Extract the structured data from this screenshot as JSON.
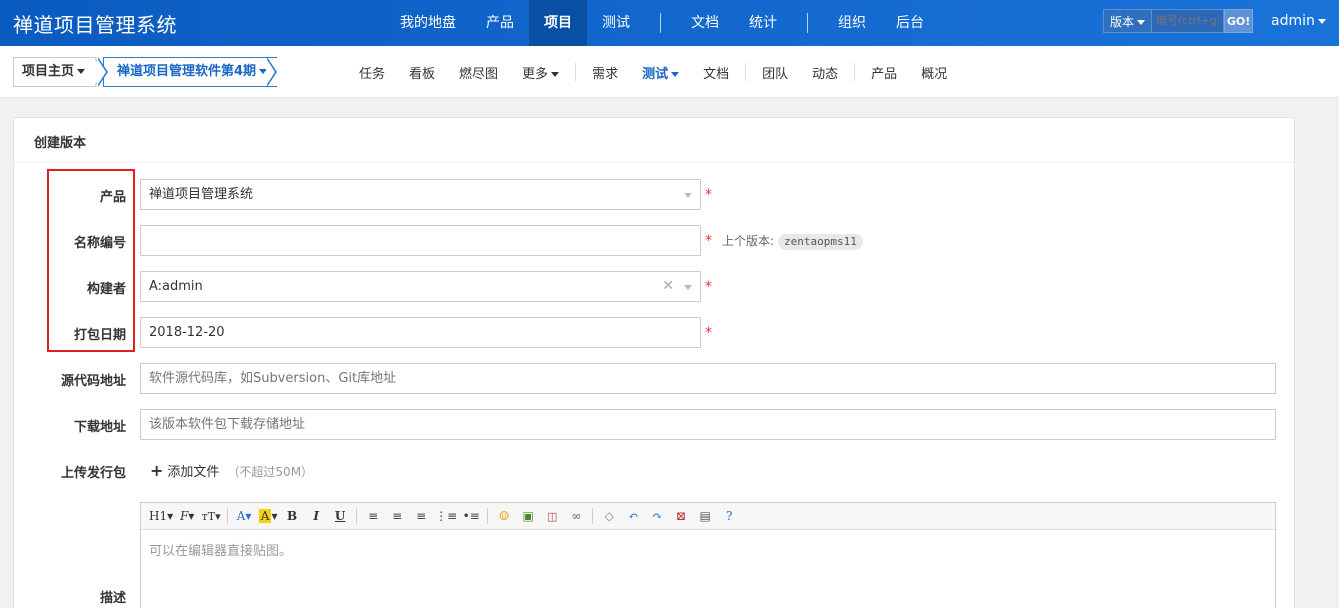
{
  "header": {
    "brand": "禅道项目管理系统",
    "nav": [
      {
        "label": "我的地盘",
        "active": false
      },
      {
        "label": "产品",
        "active": false
      },
      {
        "label": "项目",
        "active": true
      },
      {
        "label": "测试",
        "active": false
      },
      {
        "label": "文档",
        "active": false
      },
      {
        "label": "统计",
        "active": false
      },
      {
        "label": "组织",
        "active": false
      },
      {
        "label": "后台",
        "active": false
      }
    ],
    "search": {
      "type_label": "版本",
      "placeholder": "编号(ctrl+g)",
      "go_label": "GO!"
    },
    "user": "admin"
  },
  "subnav": {
    "crumb_home": "项目主页",
    "crumb_project": "禅道项目管理软件第4期",
    "menu": [
      "任务",
      "看板",
      "燃尽图",
      "更多",
      "需求",
      "测试",
      "文档",
      "团队",
      "动态",
      "产品",
      "概况"
    ]
  },
  "form": {
    "title": "创建版本",
    "product": {
      "label": "产品",
      "value": "禅道项目管理系统"
    },
    "name": {
      "label": "名称编号",
      "value": "",
      "last_version_label": "上个版本:",
      "last_version_value": "zentaopms11"
    },
    "builder": {
      "label": "构建者",
      "value": "A:admin"
    },
    "date": {
      "label": "打包日期",
      "value": "2018-12-20"
    },
    "scm": {
      "label": "源代码地址",
      "placeholder": "软件源代码库，如Subversion、Git库地址"
    },
    "download": {
      "label": "下载地址",
      "placeholder": "该版本软件包下载存储地址"
    },
    "upload": {
      "label": "上传发行包",
      "add_label": "添加文件",
      "limit": "（不超过50M）"
    },
    "desc": {
      "label": "描述",
      "placeholder": "可以在编辑器直接贴图。"
    }
  },
  "required_mark": "*",
  "colors": {
    "header_bg": "#0c64c8",
    "active_blue": "#1a66c6",
    "required_red": "#e53333",
    "highlight_box": "#e02020"
  }
}
